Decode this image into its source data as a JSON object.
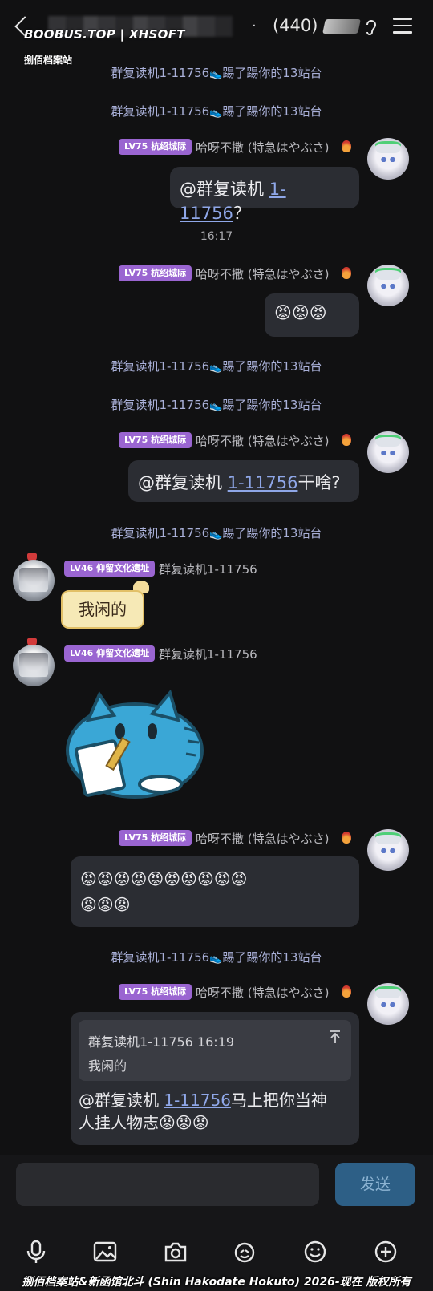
{
  "header": {
    "count": "(440)",
    "dot": "·"
  },
  "watermark": {
    "top": "BOOBUS.TOP | XHSOFT",
    "sub": "捌佰档案站",
    "bottom": "捌佰档案站&新函馆北斗 (Shin Hakodate Hokuto) 2026-现在 版权所有"
  },
  "messages": {
    "system_text": "群复读机1-11756",
    "system_suffix": "踢了踢你的13站台",
    "shoe": "👟",
    "time": "16:17",
    "me_tag": "LV75 杭绍城际",
    "me_nick": "哈呀不撒 (特急はやぶさ)",
    "other_tag": "LV46 仰留文化遗址",
    "other_nick": "群复读机1-11756",
    "mention_prefix": "@群复读机 ",
    "mention_link": "1-11756",
    "msg1_suffix": "？",
    "msg2": "😡😡😡",
    "msg3_suffix": "干啥?",
    "sticker_text": "我闲的",
    "msg4_line1": "😡😡😡😡😡😡😡😡😡😡",
    "msg4_line2": "😡😡😡",
    "reply_quote_head": "群复读机1-11756 16:19",
    "reply_quote_body": "我闲的",
    "reply_suffix": "马上把你当神",
    "reply_line2": "人挂人物志😡😡😡"
  },
  "input": {
    "send_label": "发送"
  },
  "toolbar": {
    "icons": [
      "microphone-icon",
      "image-icon",
      "camera-icon",
      "sticker-icon",
      "emoji-icon",
      "plus-icon"
    ]
  },
  "colors": {
    "background": "#111112",
    "bubble": "#2b2d33",
    "tag": "#9a65d1",
    "system_text": "#a9b0d8",
    "link": "#8fa7e8",
    "send_button": "#2d5f86"
  }
}
